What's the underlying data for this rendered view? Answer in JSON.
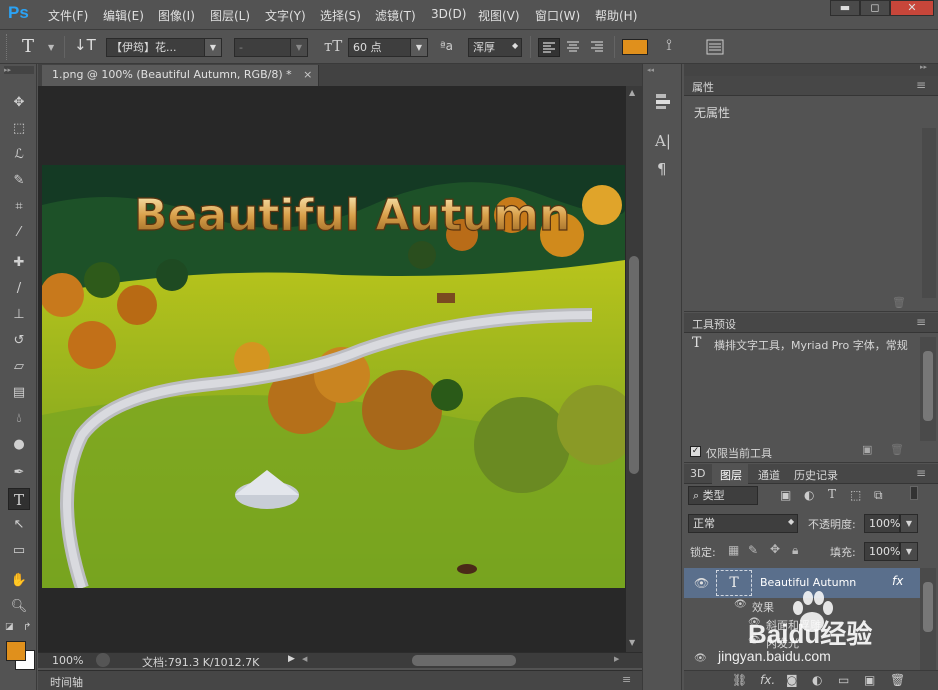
{
  "app": {
    "logo": "Ps"
  },
  "menu": [
    "文件(F)",
    "编辑(E)",
    "图像(I)",
    "图层(L)",
    "文字(Y)",
    "选择(S)",
    "滤镜(T)",
    "3D(D)",
    "视图(V)",
    "窗口(W)",
    "帮助(H)"
  ],
  "window_controls": {
    "minimize": "▬",
    "maximize": "◻",
    "close": "✕"
  },
  "options": {
    "font_family": "【伊筠】花...",
    "font_style": "-",
    "font_size": "60 点",
    "aa_label": "ªa",
    "antialias": "浑厚",
    "text_color": "#e0901c"
  },
  "document": {
    "tab_title": "1.png @ 100% (Beautiful Autumn, RGB/8) *",
    "tab_close": "×",
    "overlay_text": "Beautiful Autumn",
    "zoom": "100%",
    "doc_info": "文档:791.3 K/1012.7K"
  },
  "timeline": {
    "label": "时间轴"
  },
  "properties": {
    "title": "属性",
    "content": "无属性"
  },
  "tool_presets": {
    "title": "工具预设",
    "item": "横排文字工具，Myriad Pro 字体，常规",
    "checkbox_label": "仅限当前工具",
    "checked": true
  },
  "layers": {
    "tabs": [
      "3D",
      "图层",
      "通道",
      "历史记录"
    ],
    "active_tab": "图层",
    "filter_label": "类型",
    "blend_mode": "正常",
    "opacity_label": "不透明度:",
    "opacity": "100%",
    "lock_label": "锁定:",
    "fill_label": "填充:",
    "fill": "100%",
    "items": [
      {
        "name": "Beautiful Autumn",
        "fx": "fx"
      },
      {
        "name": "效果"
      },
      {
        "name": "斜面和浮雕"
      },
      {
        "name": "内发光"
      }
    ]
  },
  "watermark": {
    "brand": "Baidu经验",
    "url": "jingyan.baidu.com"
  }
}
